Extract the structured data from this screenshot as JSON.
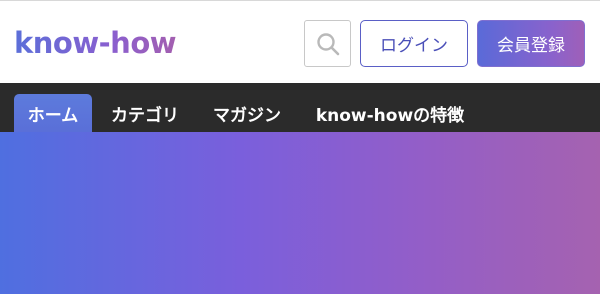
{
  "header": {
    "logo": "know-how",
    "search_icon": "search-icon",
    "login_label": "ログイン",
    "register_label": "会員登録"
  },
  "nav": {
    "items": [
      {
        "label": "ホーム",
        "active": true
      },
      {
        "label": "カテゴリ",
        "active": false
      },
      {
        "label": "マガジン",
        "active": false
      },
      {
        "label": "know-howの特徴",
        "active": false
      }
    ]
  },
  "colors": {
    "nav_bg": "#2b2b2b",
    "accent_blue": "#5a6ad8",
    "accent_purple": "#a562b0"
  }
}
